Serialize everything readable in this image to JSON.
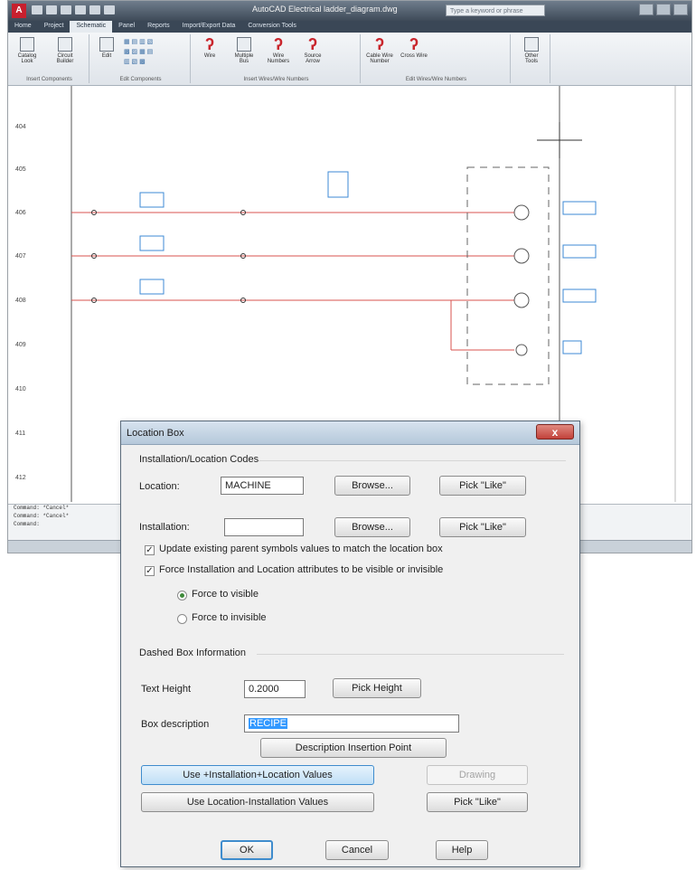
{
  "app": {
    "title": "AutoCAD Electrical  ladder_diagram.dwg",
    "search_placeholder": "Type a keyword or phrase",
    "tabs": [
      "Home",
      "Project",
      "Schematic",
      "Panel",
      "Reports",
      "Import/Export Data",
      "Conversion Tools"
    ],
    "active_tab": "Schematic",
    "ribbon_groups": [
      {
        "label": "Insert Components",
        "buttons": [
          "Catalog Look",
          "Circuit Builder"
        ]
      },
      {
        "label": "Edit Components",
        "buttons": [
          "Edit"
        ]
      },
      {
        "label": "Insert Wires/Wire Numbers",
        "buttons": [
          "Wire",
          "Multiple Bus",
          "Wire Numbers",
          "Source Arrow"
        ]
      },
      {
        "label": "Edit Wires/Wire Numbers",
        "buttons": [
          "Cable Wire Number",
          "Cross Wire"
        ]
      },
      {
        "label": "",
        "buttons": [
          "Other Tools"
        ]
      }
    ],
    "rung_numbers": [
      "404",
      "405",
      "406",
      "407",
      "408",
      "409",
      "410",
      "411",
      "412"
    ],
    "command_lines": [
      "Command: *Cancel*",
      "Command: *Cancel*",
      "Command:"
    ]
  },
  "dialog": {
    "title": "Location Box",
    "close_glyph": "x",
    "section_codes": "Installation/Location Codes",
    "location_label": "Location:",
    "location_value": "MACHINE",
    "installation_label": "Installation:",
    "installation_value": "",
    "browse_label": "Browse...",
    "pick_like_label": "Pick \"Like\"",
    "update_parent_label": "Update existing parent symbols values to match the location box",
    "update_parent_checked": true,
    "force_visible_label": "Force Installation and Location attributes to be visible or invisible",
    "force_visible_checked": true,
    "radio_visible_label": "Force to visible",
    "radio_invisible_label": "Force to invisible",
    "radio_selected": "visible",
    "section_dashed": "Dashed Box Information",
    "text_height_label": "Text Height",
    "text_height_value": "0.2000",
    "pick_height_label": "Pick Height",
    "box_desc_label": "Box description",
    "box_desc_value": "RECIPE",
    "desc_insertion_label": "Description Insertion Point",
    "use_inst_loc_label": "Use +Installation+Location Values",
    "drawing_label": "Drawing",
    "use_loc_inst_label": "Use Location-Installation Values",
    "pick_like2_label": "Pick \"Like\"",
    "ok_label": "OK",
    "cancel_label": "Cancel",
    "help_label": "Help"
  }
}
